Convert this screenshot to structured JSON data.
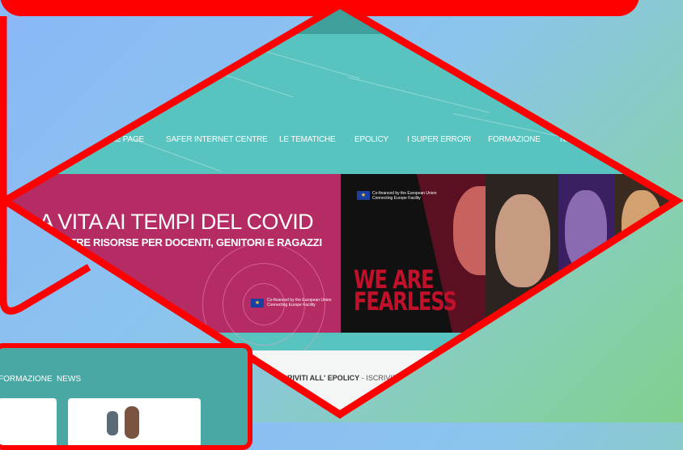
{
  "nav": {
    "items": [
      "HOME PAGE",
      "SAFER INTERNET CENTRE",
      "LE TEMATICHE",
      "EPOLICY",
      "I SUPER ERRORI",
      "FORMAZIONE",
      "NEWS"
    ]
  },
  "banner_left": {
    "title": "LA VITA AI TEMPI DEL COVID",
    "subtitle": "LE NOSTRE RISORSE PER DOCENTI, GENITORI E RAGAZZI",
    "eu_line1": "Co-financed by the European Union",
    "eu_line2": "Connecting Europe Facility"
  },
  "banner_right": {
    "eu_line1": "Co-financed by the European Union",
    "eu_line2": "Connecting Europe Facility",
    "campaign_line1": "WE ARE",
    "campaign_line2": "FEARLESS"
  },
  "announcement": {
    "bold": "ISCRIVITI ALL' EPOLICY",
    "rest": " - ISCRIVITI SUBITO"
  },
  "panel_nav": {
    "items": [
      "FORMAZIONE",
      "NEWS"
    ]
  },
  "colors": {
    "header_teal": "#58c3bf",
    "banner_magenta": "#b52b63",
    "outline_red": "#ff0000",
    "fearless_red": "#c0102a"
  }
}
